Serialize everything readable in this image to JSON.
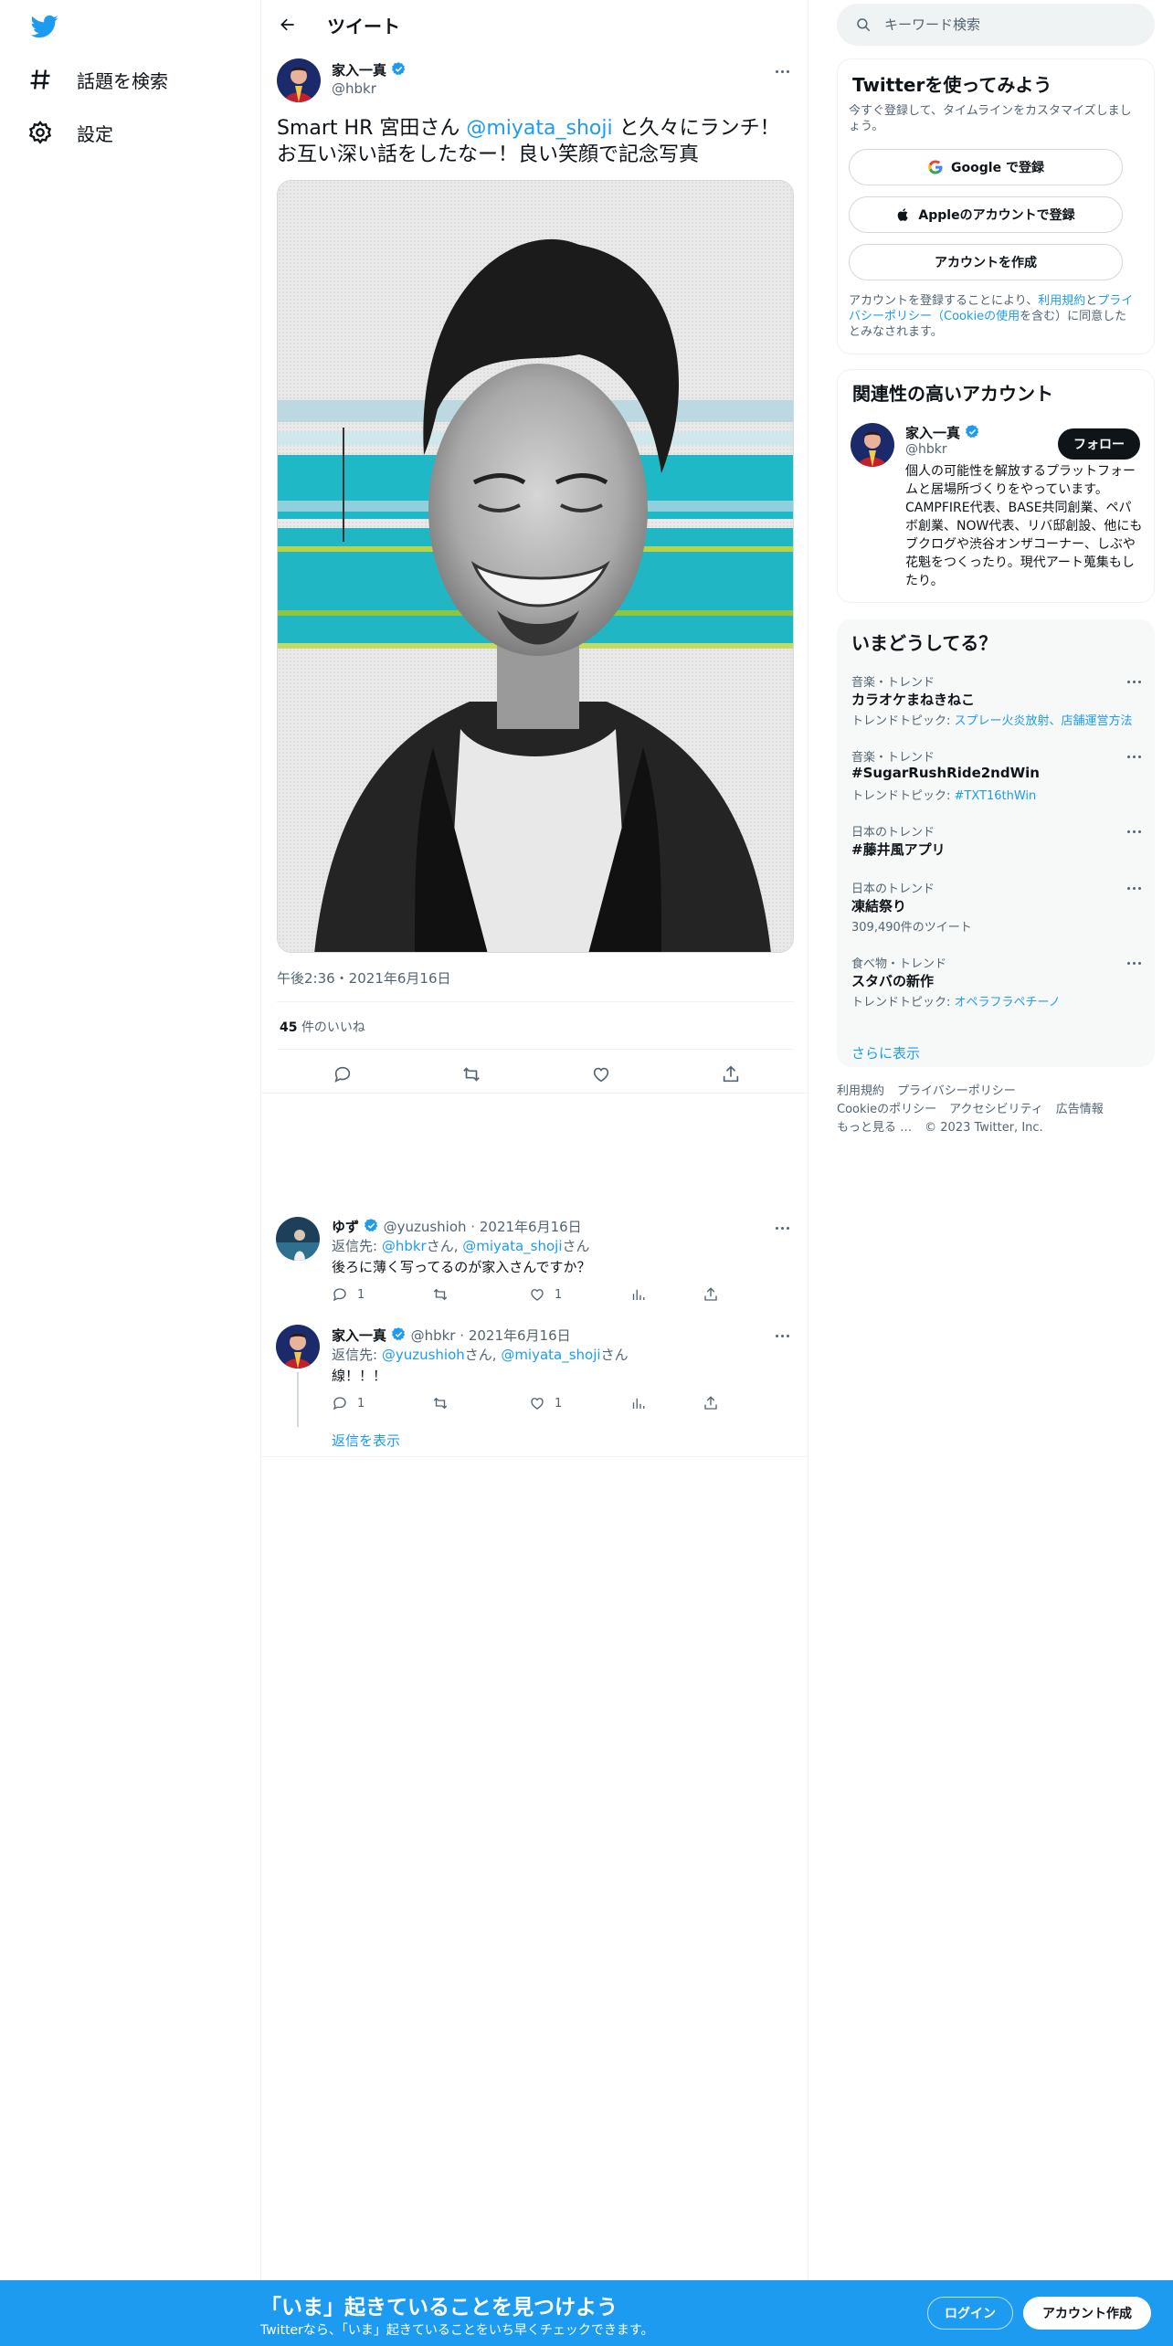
{
  "nav": {
    "items": [
      {
        "label": "話題を検索",
        "icon": "hashtag-icon"
      },
      {
        "label": "設定",
        "icon": "gear-icon"
      }
    ]
  },
  "header": {
    "title": "ツイート"
  },
  "tweet": {
    "author_name": "家入一真",
    "author_handle": "@hbkr",
    "text_before": "Smart HR 宮田さん ",
    "mention": "@miyata_shoji",
    "text_after": " と久々にランチ！お互い深い話をしたなー！良い笑顔で記念写真",
    "timestamp": "午後2:36・2021年6月16日",
    "likes_count": "45",
    "likes_label": "件のいいね"
  },
  "replies": [
    {
      "name": "ゆず",
      "handle": "@yuzushioh",
      "date": "2021年6月16日",
      "reply_prefix": "返信先: ",
      "reply_to_1": "@hbkr",
      "reply_suffix_1": "さん, ",
      "reply_to_2": "@miyata_shoji",
      "reply_suffix_2": "さん",
      "text": "後ろに薄く写ってるのが家入さんですか？",
      "reply_count": "1",
      "like_count": "1"
    },
    {
      "name": "家入一真",
      "handle": "@hbkr",
      "date": "2021年6月16日",
      "reply_prefix": "返信先: ",
      "reply_to_1": "@yuzushioh",
      "reply_suffix_1": "さん, ",
      "reply_to_2": "@miyata_shoji",
      "reply_suffix_2": "さん",
      "text": "線！！！",
      "reply_count": "1",
      "like_count": "1"
    }
  ],
  "show_replies": "返信を表示",
  "search": {
    "placeholder": "キーワード検索"
  },
  "signup_card": {
    "title": "Twitterを使ってみよう",
    "subtitle": "今すぐ登録して、タイムラインをカスタマイズしましょう。",
    "google_button": "Google で登録",
    "apple_button": "Appleのアカウントで登録",
    "create_button": "アカウントを作成",
    "terms_1": "アカウントを登録することにより、",
    "terms_link_1": "利用規約",
    "terms_2": "と",
    "terms_link_2": "プライバシーポリシー（Cookieの使用",
    "terms_3": "を含む）に同意したとみなされます。"
  },
  "related_card": {
    "title": "関連性の高いアカウント",
    "name": "家入一真",
    "handle": "@hbkr",
    "follow_label": "フォロー",
    "bio": "個人の可能性を解放するプラットフォームと居場所づくりをやっています。CAMPFIRE代表、BASE共同創業、ペパボ創業、NOW代表、リバ邸創設、他にもブクログや渋谷オンザコーナー、しぶや花魁をつくったり。現代アート蒐集もしたり。"
  },
  "trends_card": {
    "title": "いまどうしてる？",
    "items": [
      {
        "category": "音楽・トレンド",
        "name": "カラオケまねきねこ",
        "sub_prefix": "トレンドトピック: ",
        "sub_link": "スプレー火炎放射、店舗運営方法"
      },
      {
        "category": "音楽・トレンド",
        "name": "#SugarRushRide2ndWin",
        "sub_prefix": "トレンドトピック: ",
        "sub_link": "#TXT16thWin"
      },
      {
        "category": "日本のトレンド",
        "name": "#藤井風アプリ",
        "sub_prefix": "",
        "sub_link": ""
      },
      {
        "category": "日本のトレンド",
        "name": "凍結祭り",
        "sub_prefix": "309,490件のツイート",
        "sub_link": ""
      },
      {
        "category": "食べ物・トレンド",
        "name": "スタバの新作",
        "sub_prefix": "トレンドトピック: ",
        "sub_link": "オペラフラペチーノ"
      }
    ],
    "show_more": "さらに表示"
  },
  "footer": {
    "links_row1": [
      "利用規約",
      "プライバシーポリシー"
    ],
    "links_row2": [
      "Cookieのポリシー",
      "アクセシビリティ",
      "広告情報"
    ],
    "more": "もっと見る …",
    "copyright": "© 2023 Twitter, Inc."
  },
  "bottom_bar": {
    "title": "「いま」起きていることを見つけよう",
    "subtitle": "Twitterなら、「いま」起きていることをいち早くチェックできます。",
    "login": "ログイン",
    "signup": "アカウント作成"
  },
  "colors": {
    "accent": "#1d9bf0",
    "text": "#0f1419",
    "muted": "#536471",
    "border": "#eff3f4"
  }
}
